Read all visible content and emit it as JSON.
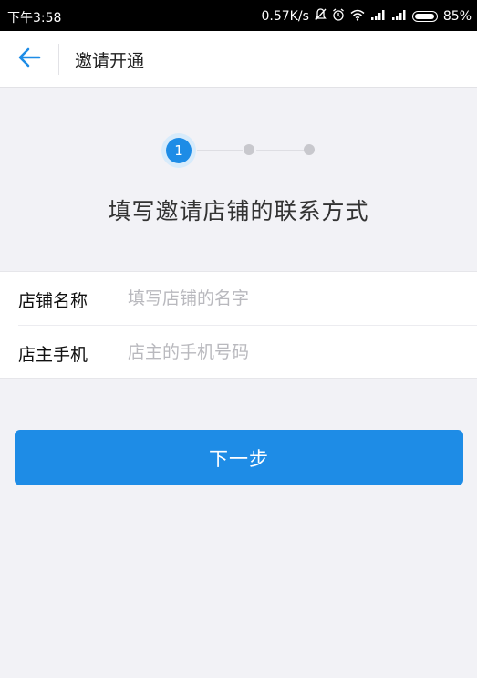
{
  "status_bar": {
    "time": "下午3:58",
    "network_speed": "0.57K/s",
    "battery": "85%",
    "icons": [
      "mute-icon",
      "alarm-icon",
      "wifi-icon",
      "signal-icon",
      "signal-icon",
      "battery-icon"
    ]
  },
  "header": {
    "back_icon": "arrow-left-icon",
    "title": "邀请开通"
  },
  "steps": {
    "active_number": "1",
    "total": 3,
    "current": 1
  },
  "heading": "填写邀请店铺的联系方式",
  "form": {
    "store_name": {
      "label": "店铺名称",
      "placeholder": "填写店铺的名字",
      "value": ""
    },
    "owner_phone": {
      "label": "店主手机",
      "placeholder": "店主的手机号码",
      "value": ""
    }
  },
  "next_button": "下一步",
  "colors": {
    "accent": "#1e8ce6",
    "background": "#f2f2f6"
  }
}
